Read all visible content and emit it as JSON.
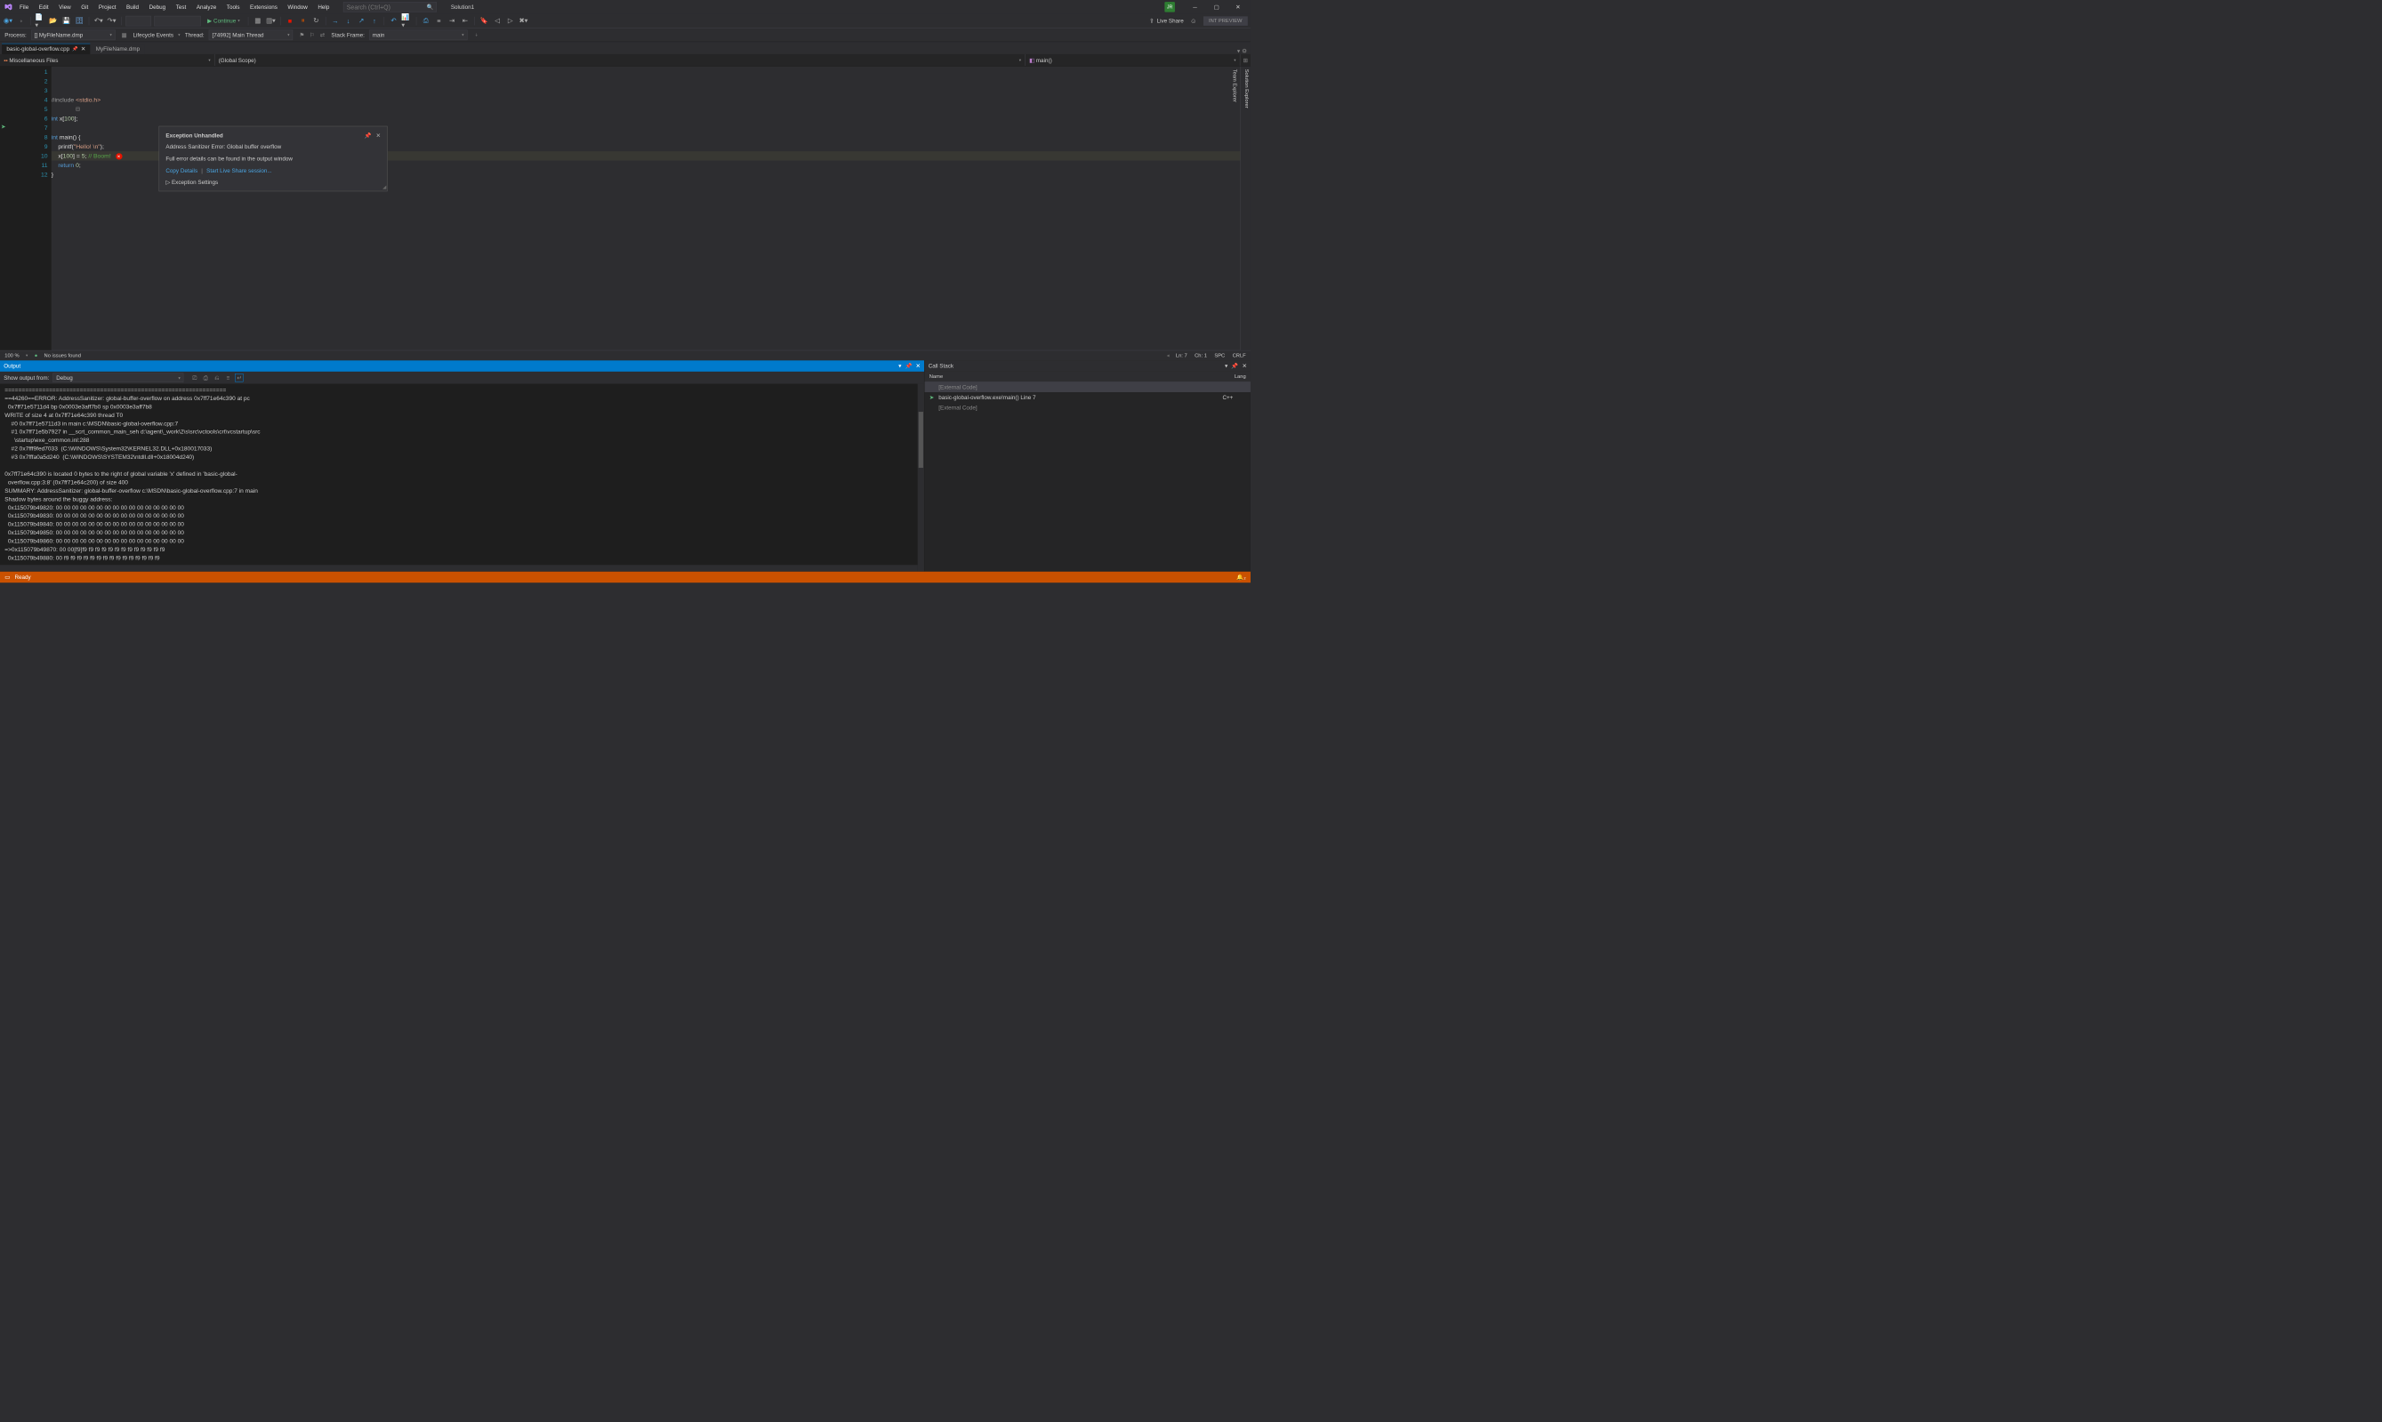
{
  "title": {
    "solution": "Solution1",
    "user_badge": "JR",
    "search_placeholder": "Search (Ctrl+Q)"
  },
  "menu": [
    "File",
    "Edit",
    "View",
    "Git",
    "Project",
    "Build",
    "Debug",
    "Test",
    "Analyze",
    "Tools",
    "Extensions",
    "Window",
    "Help"
  ],
  "toolbar": {
    "continue": "Continue",
    "live_share": "Live Share",
    "preview": "INT PREVIEW"
  },
  "debugbar": {
    "process_label": "Process:",
    "process_value": "[] MyFileName.dmp",
    "lifecycle": "Lifecycle Events",
    "thread_label": "Thread:",
    "thread_value": "[74992] Main Thread",
    "stackframe_label": "Stack Frame:",
    "stackframe_value": "main"
  },
  "tabs": [
    {
      "label": "basic-global-overflow.cpp",
      "active": true,
      "pinned": true
    },
    {
      "label": "MyFileName.dmp",
      "active": false
    }
  ],
  "navbar": {
    "scope1": "Miscellaneous Files",
    "scope2": "(Global Scope)",
    "scope3": "main()"
  },
  "side_panels": [
    "Solution Explorer",
    "Team Explorer"
  ],
  "code_lines": [
    "#include <stdio.h>",
    "",
    "int x[100];",
    "",
    "int main() {",
    "    printf(\"Hello! \\n\");",
    "    x[100] = 5; // Boom!",
    "    return 0;",
    "}",
    "",
    "",
    ""
  ],
  "exception": {
    "title": "Exception Unhandled",
    "message": "Address Sanitizer Error: Global buffer overflow",
    "hint": "Full error details can be found in the output window",
    "copy": "Copy Details",
    "liveshare": "Start Live Share session...",
    "settings": "Exception Settings"
  },
  "editor_status": {
    "zoom": "100 %",
    "issues": "No issues found",
    "ln": "Ln: 7",
    "ch": "Ch: 1",
    "spc": "SPC",
    "crlf": "CRLF"
  },
  "output": {
    "title": "Output",
    "show_from_label": "Show output from:",
    "show_from_value": "Debug",
    "text": "=================================================================\n==44260==ERROR: AddressSanitizer: global-buffer-overflow on address 0x7ff71e64c390 at pc\n  0x7ff71e5711d4 bp 0x0003e3aff7b0 sp 0x0003e3aff7b8\nWRITE of size 4 at 0x7ff71e64c390 thread T0\n    #0 0x7ff71e5711d3 in main c:\\MSDN\\basic-global-overflow.cpp:7\n    #1 0x7ff71e5b7927 in __scrt_common_main_seh d:\\agent\\_work\\2\\s\\src\\vctools\\crt\\vcstartup\\src\n      \\startup\\exe_common.inl:288\n    #2 0x7fff9fed7033  (C:\\WINDOWS\\System32\\KERNEL32.DLL+0x180017033)\n    #3 0x7fffa0a5d240  (C:\\WINDOWS\\SYSTEM32\\ntdll.dll+0x18004d240)\n\n0x7ff71e64c390 is located 0 bytes to the right of global variable 'x' defined in 'basic-global-\n  overflow.cpp:3:8' (0x7ff71e64c200) of size 400\nSUMMARY: AddressSanitizer: global-buffer-overflow c:\\MSDN\\basic-global-overflow.cpp:7 in main\nShadow bytes around the buggy address:\n  0x115079b49820: 00 00 00 00 00 00 00 00 00 00 00 00 00 00 00 00\n  0x115079b49830: 00 00 00 00 00 00 00 00 00 00 00 00 00 00 00 00\n  0x115079b49840: 00 00 00 00 00 00 00 00 00 00 00 00 00 00 00 00\n  0x115079b49850: 00 00 00 00 00 00 00 00 00 00 00 00 00 00 00 00\n  0x115079b49860: 00 00 00 00 00 00 00 00 00 00 00 00 00 00 00 00\n=>0x115079b49870: 00 00[f9]f9 f9 f9 f9 f9 f9 f9 f9 f9 f9 f9 f9 f9\n  0x115079b49880: 00 f9 f9 f9 f9 f9 f9 f9 f9 f9 f9 f9 f9 f9 f9 f9"
  },
  "callstack": {
    "title": "Call Stack",
    "col_name": "Name",
    "col_lang": "Lang",
    "rows": [
      {
        "name": "[External Code]",
        "lang": "",
        "external": true
      },
      {
        "name": "basic-global-overflow.exe!main() Line 7",
        "lang": "C++",
        "current": true
      },
      {
        "name": "[External Code]",
        "lang": "",
        "external": true
      }
    ]
  },
  "statusbar": {
    "ready": "Ready"
  }
}
